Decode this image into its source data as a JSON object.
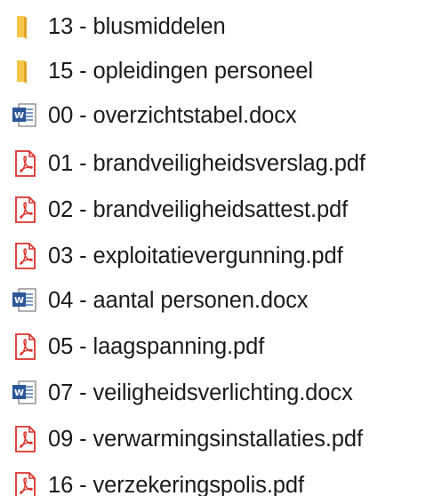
{
  "items": [
    {
      "name": "13 - blusmiddelen",
      "icon": "folder-icon"
    },
    {
      "name": "15 - opleidingen personeel",
      "icon": "folder-icon"
    },
    {
      "name": "00 - overzichtstabel.docx",
      "icon": "word-document-icon"
    },
    {
      "name": "01 - brandveiligheidsverslag.pdf",
      "icon": "pdf-icon"
    },
    {
      "name": "02 - brandveiligheidsattest.pdf",
      "icon": "pdf-icon"
    },
    {
      "name": "03 - exploitatievergunning.pdf",
      "icon": "pdf-icon"
    },
    {
      "name": "04 - aantal personen.docx",
      "icon": "word-document-icon"
    },
    {
      "name": "05 - laagspanning.pdf",
      "icon": "pdf-icon"
    },
    {
      "name": "07 - veiligheidsverlichting.docx",
      "icon": "word-document-icon"
    },
    {
      "name": "09 - verwarmingsinstallaties.pdf",
      "icon": "pdf-icon"
    },
    {
      "name": "16 - verzekeringspolis.pdf",
      "icon": "pdf-icon"
    }
  ],
  "colors": {
    "folder": "#f8c64a",
    "folder_shadow": "#e0a526",
    "pdf_red": "#d9322b",
    "word_blue": "#2b5797",
    "text": "#1b1b1b"
  }
}
